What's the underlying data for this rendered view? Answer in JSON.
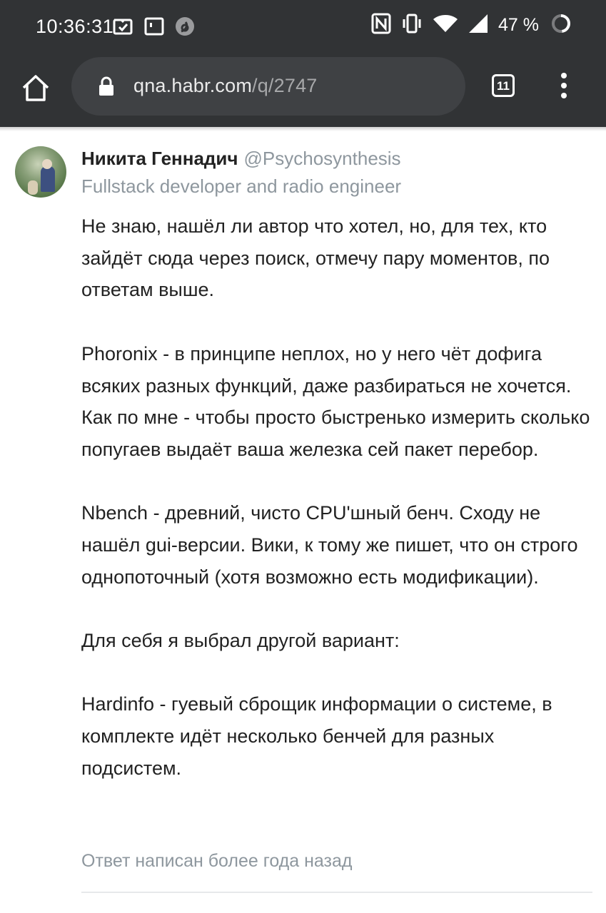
{
  "status_bar": {
    "time": "10:36:31",
    "battery_percent": "47 %",
    "icons": [
      "image-check-icon",
      "screen-icon",
      "app-icon",
      "nfc-icon",
      "vibrate-icon",
      "wifi-icon",
      "signal-icon",
      "battery-icon"
    ]
  },
  "browser": {
    "url_host": "qna.habr.com",
    "url_path": "/q/2747",
    "tab_count": "11",
    "colors": {
      "toolbar": "#313335",
      "urlbar": "#3f4144"
    }
  },
  "answer": {
    "author_name": "Никита Геннадич",
    "author_handle": "@Psychosynthesis",
    "author_role": "Fullstack developer and radio engineer",
    "paragraphs": [
      "Не знаю, нашёл ли автор что хотел, но, для тех, кто зайдёт сюда через поиск, отмечу пару моментов, по ответам выше.",
      "Phoronix - в принципе неплох, но у него чёт дофига всяких разных функций, даже разбираться не хочется. Как по мне - чтобы просто быстренько измерить сколько попугаев выдаёт ваша железка сей пакет перебор.",
      "Nbench - древний, чисто CPU'шный бенч. Сходу не нашёл gui-версии. Вики, к тому же пишет, что он строго однопоточный (хотя возможно есть модификации).",
      "Для себя я выбрал другой вариант:",
      "Hardinfo - гуевый сброщик информации о системе, в комплекте идёт несколько бенчей для разных подсистем."
    ],
    "meta": "Ответ написан более года назад"
  }
}
